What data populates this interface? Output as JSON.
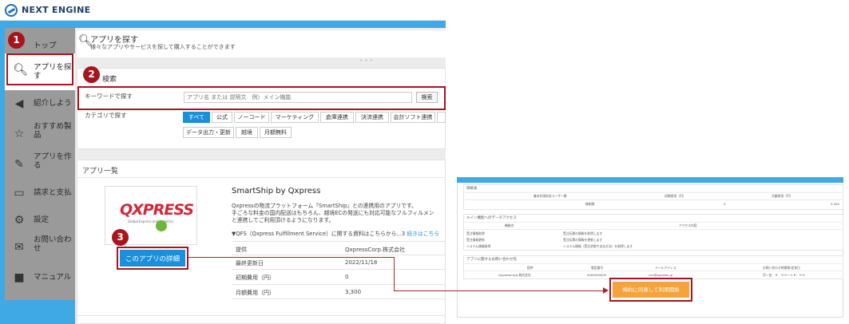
{
  "header": {
    "logo_text": "NEXT ENGINE"
  },
  "sidebar": {
    "items": [
      {
        "label": "トップ",
        "icon": "home-icon"
      },
      {
        "label": "アプリを探す",
        "icon": "search-icon"
      },
      {
        "label": "紹介しよう",
        "icon": "megaphone-icon"
      },
      {
        "label": "おすすめ製品",
        "icon": "star-icon"
      },
      {
        "label": "アプリを作る",
        "icon": "edit-icon"
      },
      {
        "label": "請求と支払",
        "icon": "card-icon"
      },
      {
        "label": "設定",
        "icon": "gear-icon"
      },
      {
        "label": "お問い合わせ",
        "icon": "mail-icon"
      },
      {
        "label": "マニュアル",
        "icon": "book-icon"
      }
    ]
  },
  "page": {
    "title": "アプリを探す",
    "subtitle": "様々なアプリやサービスを探して購入することができます"
  },
  "search": {
    "heading": "検索",
    "keyword_label": "キーワードで探す",
    "keyword_placeholder": "アプリ名 または 説明文　例）メイン機能",
    "search_button": "検索",
    "category_label": "カテゴリで探す",
    "categories": [
      "すべて",
      "公式",
      "ノーコード",
      "マーケティング",
      "倉庫連携",
      "決済連携",
      "会計ソフト連携",
      "データ出力・更新",
      "越境",
      "月額無料"
    ]
  },
  "list": {
    "heading": "アプリ一覧",
    "app": {
      "logo_text": "QXPRESS",
      "logo_tag": "Global Express and Logistics",
      "name": "SmartShip by Qxpress",
      "desc_line1": "Qxpressの物流プラットフォーム『SmartShip』との連携用のアプリです。",
      "desc_line2": "手ごろな料金の国内配送はもちろん、越境ECの発送にも対応可能なフルフィルメン",
      "desc_line3": "と連携してご利用頂けるようになります。",
      "qfs_text": "▼QFS（Qxpress Fulfillment Service）に関する資料はこちらから...3",
      "qfs_link": "続きはこちら",
      "detail_button": "このアプリの詳細",
      "rows": [
        {
          "key": "提供",
          "value": "QxpressCorp.株式会社"
        },
        {
          "key": "最終更新日",
          "value": "2022/11/18"
        },
        {
          "key": "初期費用（円）",
          "value": "0"
        },
        {
          "key": "月額費用（円）",
          "value": "3,300"
        }
      ]
    }
  },
  "detail_page": {
    "section1_title": "価格表",
    "section1_cols": [
      "基本利用料金ユーザー数",
      "初期費用（円）",
      "月額費用（円）"
    ],
    "section1_row": [
      "無制限",
      "0",
      "3,300"
    ],
    "section2_title": "メイン機能へのデータアクセス",
    "section2_cols": [
      "機能名",
      "アクセス内容"
    ],
    "section2_rows": [
      [
        "受注情報取得",
        "受注伝票の情報を取得します"
      ],
      [
        "受注情報更新",
        "受注伝票の情報を更新します"
      ],
      [
        "システム情報取得",
        "システム情報（受注状態や支払方法）を取得します"
      ]
    ],
    "section3_title": "アプリに関するお問い合わせ先",
    "section3_cols": [
      "提供",
      "電話番号",
      "メールアドレス",
      "お問い合わせ時間帯/定休日"
    ],
    "section3_row": [
      "QxpressCorp.株式会社",
      "0000000000",
      "xxx@qxpress.jp",
      "月～金　９：００～１８：００"
    ],
    "agree_button": "規約に同意して利用開始"
  },
  "annotations": {
    "step1": "1",
    "step2": "2",
    "step3": "3"
  },
  "colors": {
    "accent": "#1a8fdb",
    "annotation": "#a8141c",
    "brand_blue": "#3fa9e6",
    "cta_orange": "#f5a33a"
  }
}
